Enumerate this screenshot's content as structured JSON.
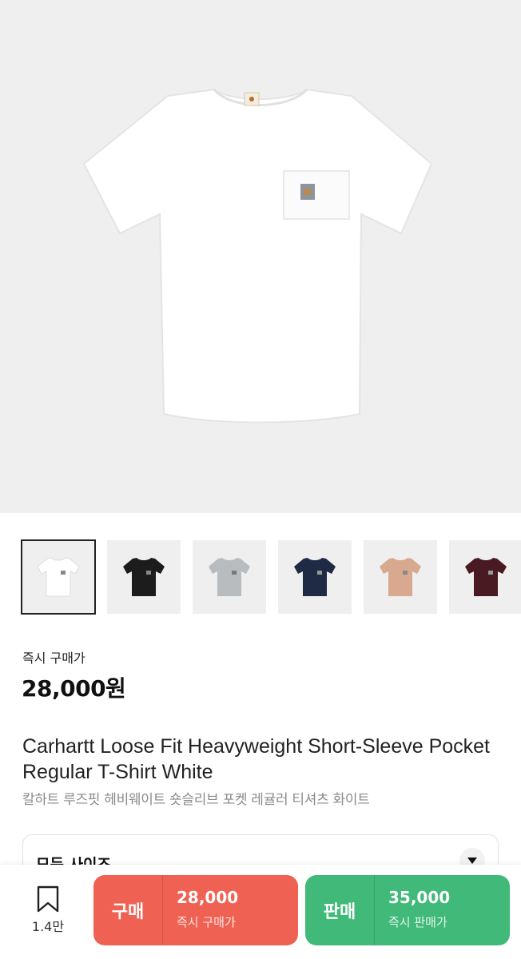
{
  "product": {
    "price_label": "즉시 구매가",
    "price": "28,000원",
    "title": "Carhartt Loose Fit Heavyweight Short-Sleeve Pocket Regular T-Shirt White",
    "subtitle": "칼하트 루즈핏 헤비웨이트 숏슬리브 포켓 레귤러 티셔츠 화이트"
  },
  "thumbnails": [
    {
      "color_name": "white",
      "color": "#f5f5f5",
      "selected": true
    },
    {
      "color_name": "black",
      "color": "#1c1c1c",
      "selected": false
    },
    {
      "color_name": "grey",
      "color": "#b9bcbf",
      "selected": false
    },
    {
      "color_name": "navy",
      "color": "#1f2a44",
      "selected": false
    },
    {
      "color_name": "beige",
      "color": "#d9a98f",
      "selected": false
    },
    {
      "color_name": "burgundy",
      "color": "#4a1a22",
      "selected": false
    }
  ],
  "size_select": {
    "label": "모든 사이즈"
  },
  "bottom_bar": {
    "wish_count": "1.4만",
    "buy": {
      "label": "구매",
      "price": "28,000",
      "sub": "즉시 구매가",
      "color": "#ef6253"
    },
    "sell": {
      "label": "판매",
      "price": "35,000",
      "sub": "즉시 판매가",
      "color": "#41b979"
    }
  }
}
